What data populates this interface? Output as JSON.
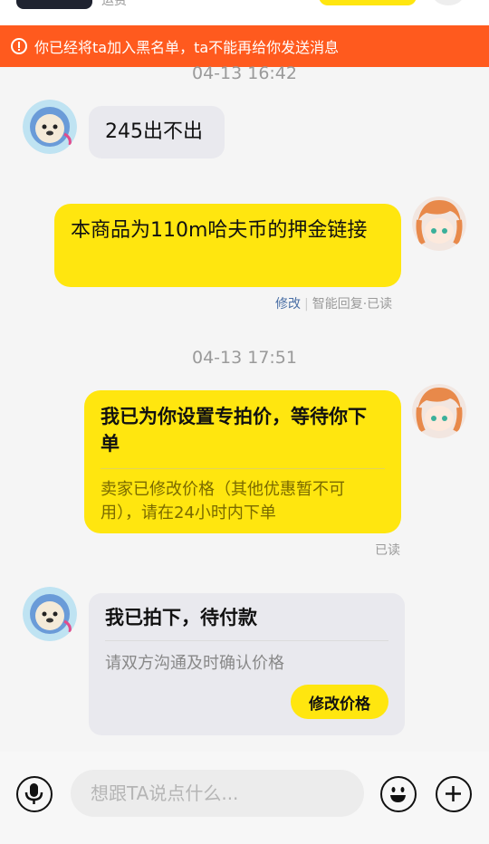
{
  "banner": {
    "text": "你已经将ta加入黑名单，ta不能再给你发送消息"
  },
  "top": {
    "sub_text": "运费"
  },
  "timestamps": [
    "04-13 16:42",
    "04-13 17:51"
  ],
  "messages": {
    "m1": {
      "text": "245出不出"
    },
    "m2": {
      "text": "本商品为110m哈夫币的押金链接"
    },
    "m2_meta": {
      "edit": "修改",
      "smart": "智能回复·已读"
    },
    "m3": {
      "title": "我已为你设置专拍价，等待你下单",
      "sub": "卖家已修改价格（其他优惠暂不可用），请在24小时内下单"
    },
    "m3_meta": {
      "read": "已读"
    },
    "m4": {
      "title": "我已拍下，待付款",
      "sub": "请双方沟通及时确认价格",
      "button": "修改价格"
    }
  },
  "input": {
    "placeholder": "想跟TA说点什么..."
  },
  "icons": {
    "banner": "alert-circle-icon",
    "mic": "microphone-icon",
    "emoji": "smiley-icon",
    "add": "plus-icon"
  },
  "colors": {
    "accent": "#ffe60f",
    "banner": "#ff5a1e",
    "link": "#4a6fa5"
  }
}
